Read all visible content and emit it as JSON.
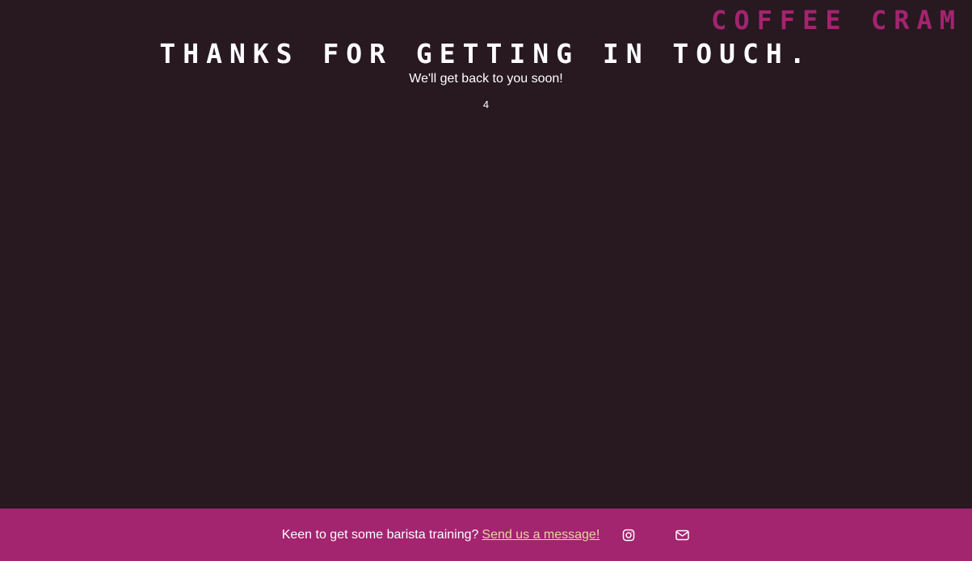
{
  "header": {
    "brand": "COFFEE CRAM"
  },
  "main": {
    "headline": "THANKS FOR GETTING IN TOUCH.",
    "subtext": "We'll get back to you soon!",
    "countdown": "4"
  },
  "footer": {
    "prompt": "Keen to get some barista training?",
    "link_text": "Send us a message!",
    "icons": [
      "instagram-icon",
      "mail-icon"
    ]
  },
  "colors": {
    "background": "#281820",
    "accent": "#a3246f",
    "link": "#e7d6a2",
    "text": "#ffffff"
  }
}
